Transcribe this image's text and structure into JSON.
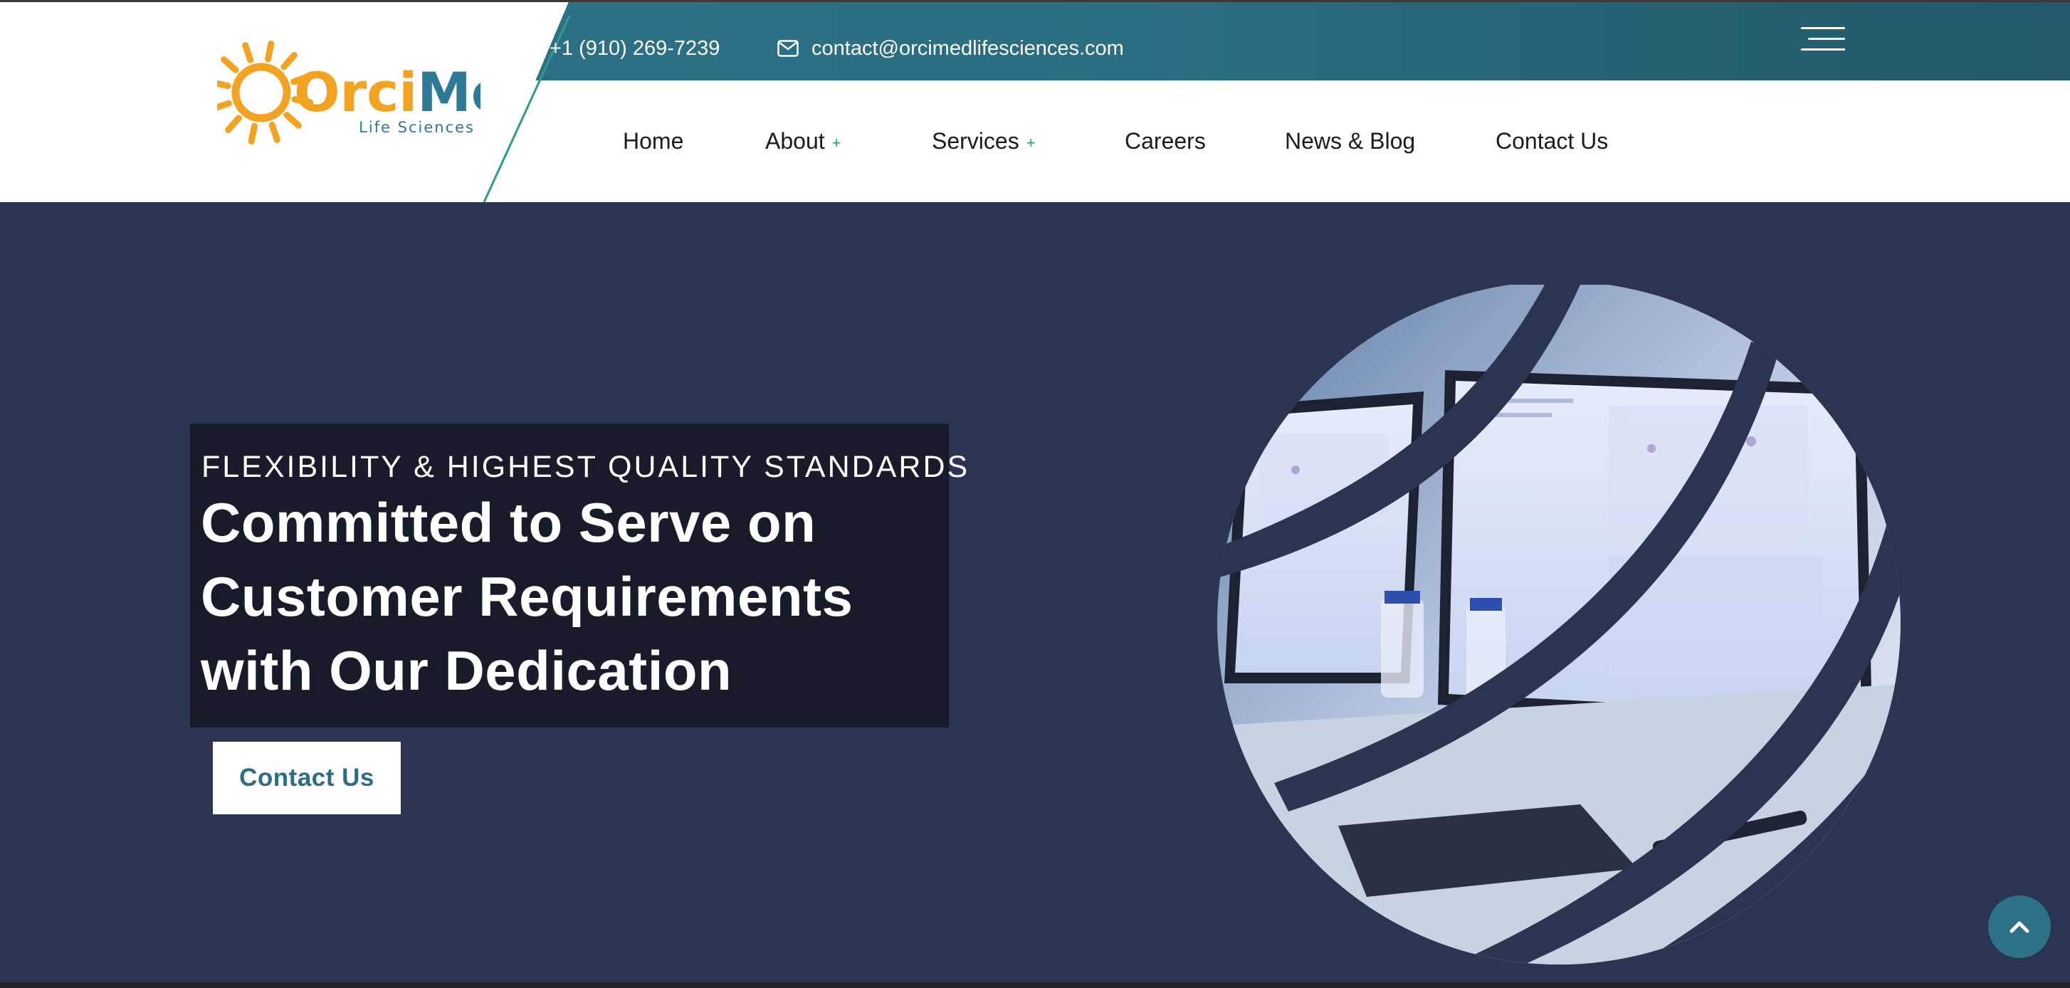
{
  "header": {
    "logo": {
      "brand": "OrciMed",
      "brand_part1": "Orci",
      "brand_part2": "Med",
      "tagline": "Life Sciences",
      "icon": "sun-logo-icon"
    },
    "phone": "+1 (910) 269-7239",
    "email": "contact@orcimedlifesciences.com",
    "email_icon": "envelope-icon",
    "menu_icon": "hamburger-menu-icon"
  },
  "nav": {
    "items": [
      {
        "label": "Home"
      },
      {
        "label": "About",
        "submenu_marker": "+"
      },
      {
        "label": "Services",
        "submenu_marker": "+"
      },
      {
        "label": "Careers"
      },
      {
        "label": "News & Blog"
      },
      {
        "label": "Contact Us"
      }
    ]
  },
  "hero": {
    "tagline": "FLEXIBILITY & HIGHEST QUALITY STANDARDS",
    "headline": "Committed to Serve on Customer Requirements with Our Dedication",
    "cta_label": "Contact Us"
  },
  "scroll_top_icon": "chevron-up-icon",
  "colors": {
    "topbar": "#2c7287",
    "hero_bg": "#2b3450",
    "hero_box": "#181c2a",
    "accent_teal": "#2d9a8a",
    "logo_orange": "#f2a321",
    "logo_blue": "#2e7a96"
  }
}
